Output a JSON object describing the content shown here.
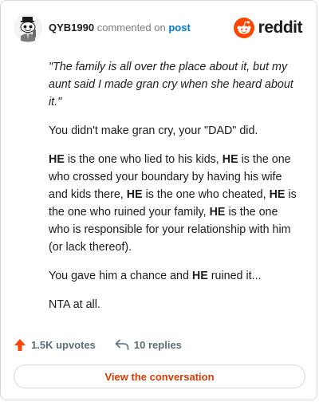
{
  "header": {
    "username": "QYB1990",
    "commented_on": "commented on",
    "post_link": "post",
    "logo_text": "reddit",
    "brand_color": "#ff4500"
  },
  "comment": {
    "quote": "\"The family is all over the place about it, but my aunt said I made gran cry when she heard about it.\"",
    "p2": "You didn't make gran cry, your \"DAD\" did.",
    "p3": {
      "he": "HE",
      "s1": " is the one who lied to his kids, ",
      "s2": " is the one who crossed your boundary by having his wife and kids there, ",
      "s3": " is the one who cheated, ",
      "s4": " is the one who ruined your family, ",
      "s5": " is the one who is responsible for your relationship with him (or lack thereof)."
    },
    "p4": {
      "a": "You gave him a chance and ",
      "he": "HE",
      "b": " ruined it..."
    },
    "p5": "NTA at all."
  },
  "actions": {
    "upvotes": "1.5K upvotes",
    "upvote_icon": "upvote-arrow-icon",
    "replies": "10 replies",
    "reply_icon": "reply-arrow-icon"
  },
  "footer": {
    "view_label": "View the conversation",
    "accent_color": "#d93a00"
  }
}
